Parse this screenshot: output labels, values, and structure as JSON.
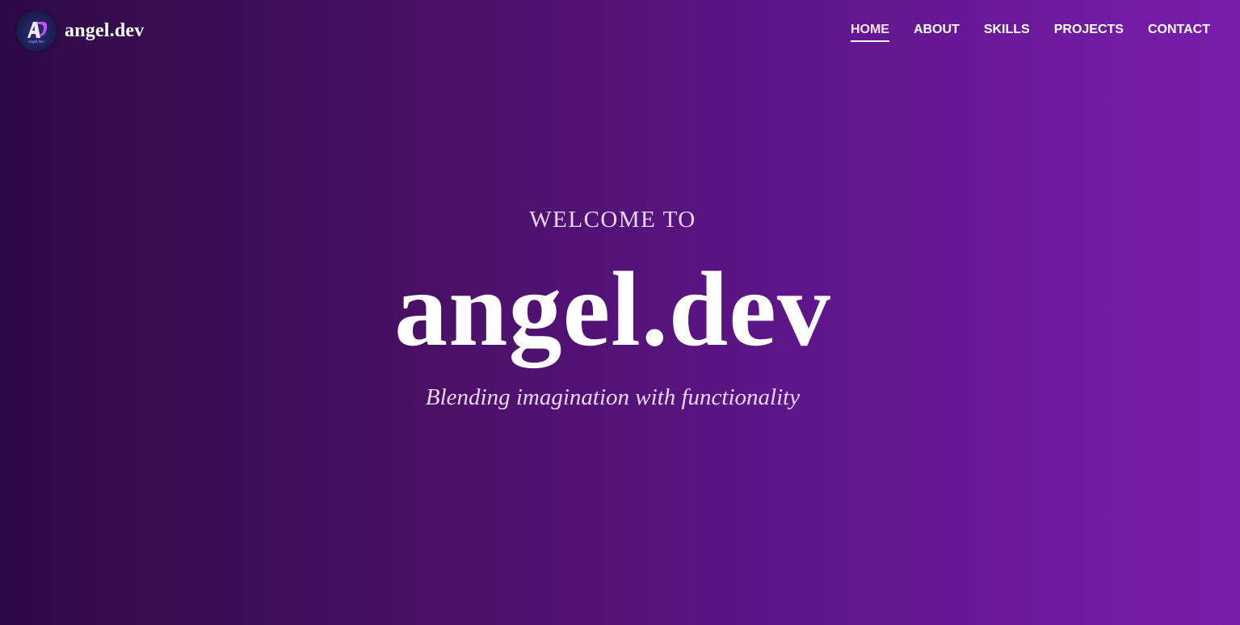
{
  "brand": {
    "name": "angel.dev",
    "logo_text": "AD",
    "logo_icon": "ad-monogram-logo"
  },
  "nav": {
    "items": [
      {
        "label": "HOME",
        "active": true
      },
      {
        "label": "ABOUT",
        "active": false
      },
      {
        "label": "SKILLS",
        "active": false
      },
      {
        "label": "PROJECTS",
        "active": false
      },
      {
        "label": "CONTACT",
        "active": false
      }
    ]
  },
  "hero": {
    "welcome": "WELCOME TO",
    "title": "angel.dev",
    "tagline": "Blending imagination with functionality"
  },
  "colors": {
    "background_start": "#2e0a45",
    "background_end": "#7a1dad",
    "text": "#ffffff",
    "muted_text": "#ead7f7"
  }
}
